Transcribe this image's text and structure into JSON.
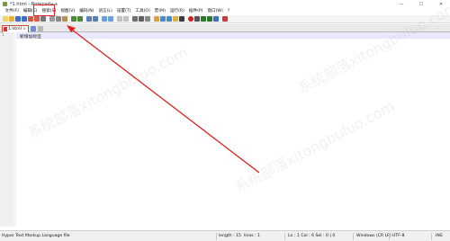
{
  "titlebar": {
    "title": "*1.html - Notepad++",
    "minimize": "—",
    "maximize": "☐",
    "close": "✕"
  },
  "menubar": {
    "items": [
      "文件(F)",
      "编辑(E)",
      "搜索(S)",
      "视图(V)",
      "编码(N)",
      "语言(L)",
      "设置(T)",
      "工具(O)",
      "宏(M)",
      "运行(R)",
      "插件(P)",
      "窗口(W)",
      "?"
    ]
  },
  "toolbar": {
    "icons": [
      "new-file-icon",
      "open-file-icon",
      "save-icon",
      "save-all-icon",
      "close-icon",
      "close-all-icon",
      "print-icon",
      "cut-icon",
      "copy-icon",
      "paste-icon",
      "undo-icon",
      "redo-icon",
      "find-icon",
      "replace-icon",
      "zoom-in-icon",
      "zoom-out-icon",
      "sync-v-icon",
      "sync-h-icon",
      "word-wrap-icon",
      "show-all-icon",
      "indent-guide-icon",
      "udl-icon",
      "doc-map-icon",
      "function-list-icon",
      "folder-workspace-icon",
      "monitor-icon",
      "record-icon",
      "stop-icon",
      "play-icon",
      "play-multiple-icon",
      "save-macro-icon",
      "spell-icon"
    ]
  },
  "tabs": [
    {
      "label": "1.html",
      "close": "x"
    }
  ],
  "editor": {
    "line_number": "1",
    "content": "新增加标签"
  },
  "statusbar": {
    "language": "Hyper Text Markup Language file",
    "length": "length : 15",
    "lines": "lines : 1",
    "position": "Ln : 1    Col : 6    Sel : 0 | 0",
    "eol": "Windows (CR LF)",
    "encoding": "UTF-8",
    "mode": "INS"
  },
  "watermark": {
    "text": "系统部落xitongbuluo.com"
  },
  "colors": {
    "annotation": "#e02020",
    "current_line": "#e8e8ff"
  }
}
